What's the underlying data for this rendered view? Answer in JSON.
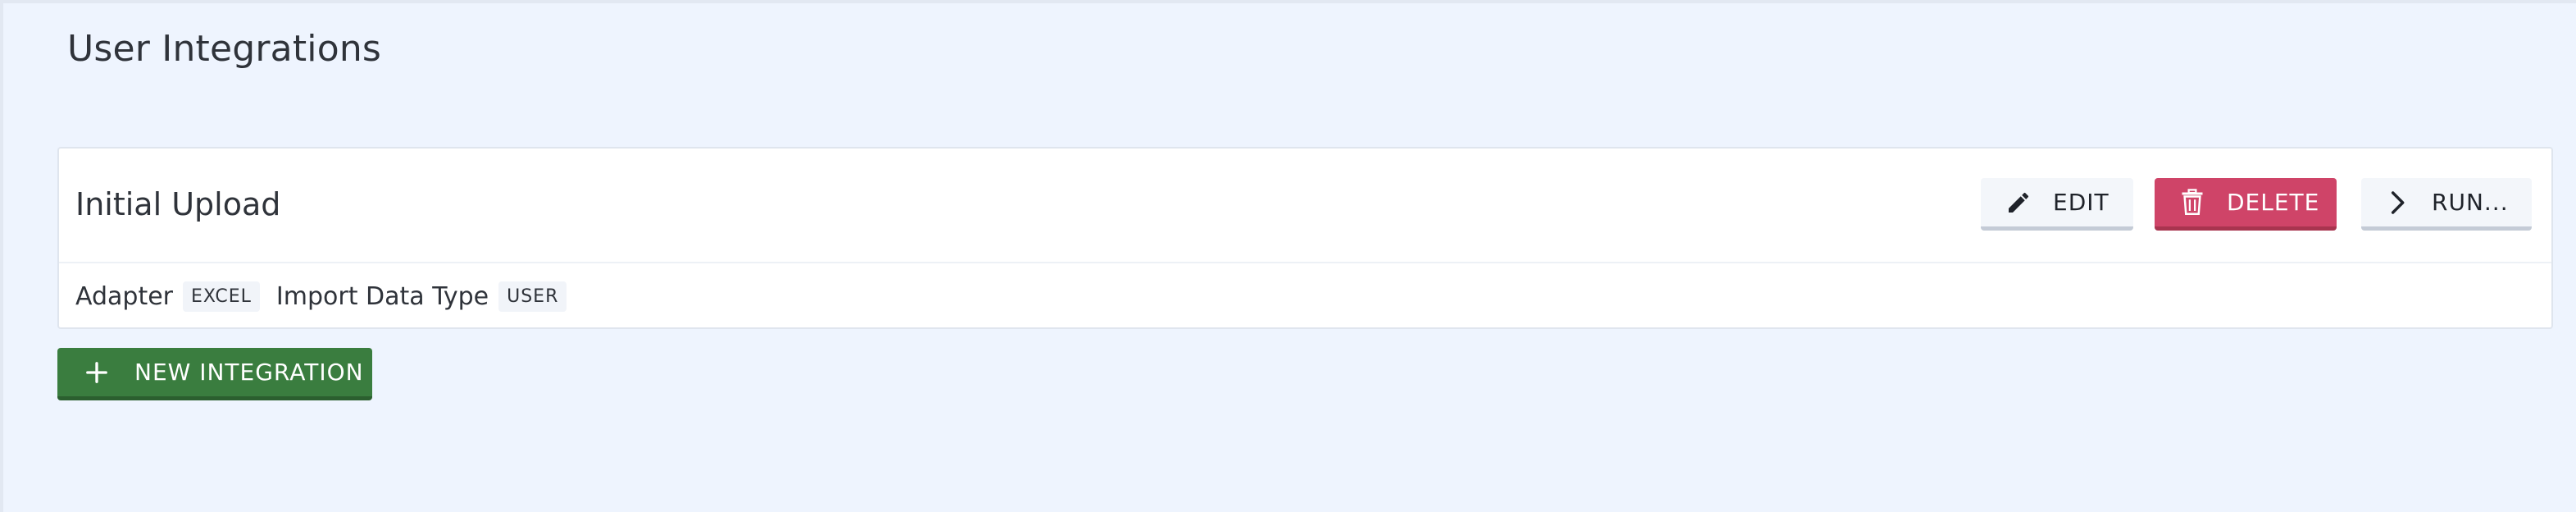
{
  "page": {
    "title": "User Integrations"
  },
  "integration": {
    "name": "Initial Upload",
    "actions": {
      "edit_label": "EDIT",
      "delete_label": "DELETE",
      "run_label": "RUN..."
    },
    "details": {
      "adapter_label": "Adapter",
      "adapter_value": "EXCEL",
      "import_type_label": "Import Data Type",
      "import_type_value": "USER"
    }
  },
  "footer": {
    "new_integration_label": "NEW INTEGRATION"
  },
  "icons": {
    "edit": "pencil-icon",
    "delete": "trash-icon",
    "run": "chevron-right-icon",
    "new": "plus-icon"
  },
  "colors": {
    "background": "#eef4fe",
    "danger": "#cf4468",
    "success": "#3a7d3f"
  }
}
